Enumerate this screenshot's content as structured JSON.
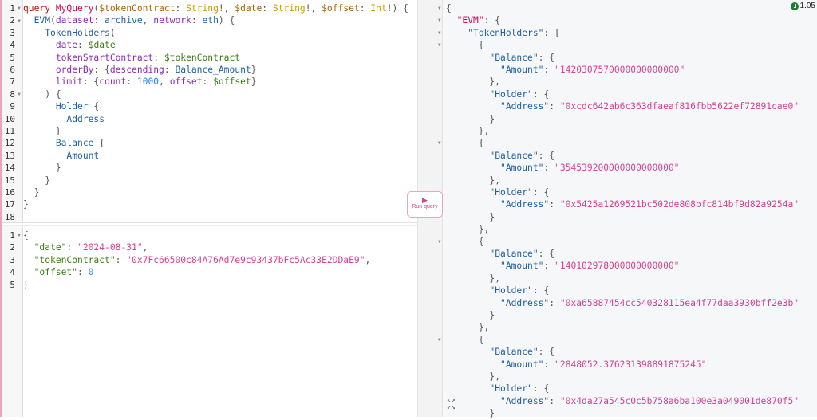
{
  "query": {
    "lines": [
      [
        [
          "query ",
          "kw"
        ],
        [
          "MyQuery",
          "def"
        ],
        [
          "(",
          "punc"
        ],
        [
          "$tokenContract",
          "var"
        ],
        [
          ": ",
          "punc"
        ],
        [
          "String",
          "type"
        ],
        [
          "!, ",
          "punc"
        ],
        [
          "$date",
          "var"
        ],
        [
          ": ",
          "punc"
        ],
        [
          "String",
          "type"
        ],
        [
          "!, ",
          "punc"
        ],
        [
          "$offset",
          "var"
        ],
        [
          ": ",
          "punc"
        ],
        [
          "Int",
          "type"
        ],
        [
          "!) {",
          "punc"
        ]
      ],
      [
        [
          "  ",
          "punc"
        ],
        [
          "EVM",
          "field"
        ],
        [
          "(",
          "punc"
        ],
        [
          "dataset",
          "arg"
        ],
        [
          ": ",
          "punc"
        ],
        [
          "archive",
          "val"
        ],
        [
          ", ",
          "punc"
        ],
        [
          "network",
          "arg"
        ],
        [
          ": ",
          "punc"
        ],
        [
          "eth",
          "val"
        ],
        [
          ") {",
          "punc"
        ]
      ],
      [
        [
          "    ",
          "punc"
        ],
        [
          "TokenHolders",
          "field"
        ],
        [
          "(",
          "punc"
        ]
      ],
      [
        [
          "      ",
          "punc"
        ],
        [
          "date",
          "arg"
        ],
        [
          ": ",
          "punc"
        ],
        [
          "$date",
          "green"
        ]
      ],
      [
        [
          "      ",
          "punc"
        ],
        [
          "tokenSmartContract",
          "arg"
        ],
        [
          ": ",
          "punc"
        ],
        [
          "$tokenContract",
          "green"
        ]
      ],
      [
        [
          "      ",
          "punc"
        ],
        [
          "orderBy",
          "arg"
        ],
        [
          ": {",
          "punc"
        ],
        [
          "descending",
          "arg"
        ],
        [
          ": ",
          "punc"
        ],
        [
          "Balance_Amount",
          "val"
        ],
        [
          "}",
          "punc"
        ]
      ],
      [
        [
          "      ",
          "punc"
        ],
        [
          "limit",
          "arg"
        ],
        [
          ": {",
          "punc"
        ],
        [
          "count",
          "arg"
        ],
        [
          ": ",
          "punc"
        ],
        [
          "1000",
          "num"
        ],
        [
          ", ",
          "punc"
        ],
        [
          "offset",
          "arg"
        ],
        [
          ": ",
          "punc"
        ],
        [
          "$offset",
          "green"
        ],
        [
          "}",
          "punc"
        ]
      ],
      [
        [
          "    ) {",
          "punc"
        ]
      ],
      [
        [
          "      ",
          "punc"
        ],
        [
          "Holder",
          "field"
        ],
        [
          " {",
          "punc"
        ]
      ],
      [
        [
          "        ",
          "punc"
        ],
        [
          "Address",
          "field"
        ]
      ],
      [
        [
          "      }",
          "punc"
        ]
      ],
      [
        [
          "      ",
          "punc"
        ],
        [
          "Balance",
          "field"
        ],
        [
          " {",
          "punc"
        ]
      ],
      [
        [
          "        ",
          "punc"
        ],
        [
          "Amount",
          "field"
        ]
      ],
      [
        [
          "      }",
          "punc"
        ]
      ],
      [
        [
          "    }",
          "punc"
        ]
      ],
      [
        [
          "  }",
          "punc"
        ]
      ],
      [
        [
          "}",
          "punc"
        ]
      ],
      [
        [
          "",
          "punc"
        ]
      ]
    ],
    "folds": [
      1,
      2,
      8
    ]
  },
  "variables": {
    "lines": [
      [
        [
          "{",
          "punc"
        ]
      ],
      [
        [
          "  ",
          "punc"
        ],
        [
          "\"date\"",
          "vkey"
        ],
        [
          ": ",
          "punc"
        ],
        [
          "\"2024-08-31\"",
          "str"
        ],
        [
          ",",
          "punc"
        ]
      ],
      [
        [
          "  ",
          "punc"
        ],
        [
          "\"tokenContract\"",
          "vkey"
        ],
        [
          ": ",
          "punc"
        ],
        [
          "\"0x7Fc66500c84A76Ad7e9c93437bFc5Ac33E2DDaE9\"",
          "str"
        ],
        [
          ",",
          "punc"
        ]
      ],
      [
        [
          "  ",
          "punc"
        ],
        [
          "\"offset\"",
          "vkey"
        ],
        [
          ": ",
          "punc"
        ],
        [
          "0",
          "num"
        ]
      ],
      [
        [
          "}",
          "punc"
        ]
      ]
    ],
    "folds": [
      1
    ]
  },
  "run_button": {
    "label": "Run query"
  },
  "timer": {
    "value": "1.05"
  },
  "result": {
    "lines": [
      [
        [
          "{",
          "punc"
        ]
      ],
      [
        [
          "  ",
          "punc"
        ],
        [
          "\"EVM\"",
          "def"
        ],
        [
          ": {",
          "punc"
        ]
      ],
      [
        [
          "    ",
          "punc"
        ],
        [
          "\"TokenHolders\"",
          "key"
        ],
        [
          ": [",
          "punc"
        ]
      ],
      [
        [
          "      {",
          "punc"
        ]
      ],
      [
        [
          "        ",
          "punc"
        ],
        [
          "\"Balance\"",
          "key"
        ],
        [
          ": {",
          "punc"
        ]
      ],
      [
        [
          "          ",
          "punc"
        ],
        [
          "\"Amount\"",
          "key"
        ],
        [
          ": ",
          "punc"
        ],
        [
          "\"1420307570000000000000\"",
          "str"
        ]
      ],
      [
        [
          "        },",
          "punc"
        ]
      ],
      [
        [
          "        ",
          "punc"
        ],
        [
          "\"Holder\"",
          "key"
        ],
        [
          ": {",
          "punc"
        ]
      ],
      [
        [
          "          ",
          "punc"
        ],
        [
          "\"Address\"",
          "key"
        ],
        [
          ": ",
          "punc"
        ],
        [
          "\"0xcdc642ab6c363dfaeaf816fbb5622ef72891cae0\"",
          "str"
        ]
      ],
      [
        [
          "        }",
          "punc"
        ]
      ],
      [
        [
          "      },",
          "punc"
        ]
      ],
      [
        [
          "      {",
          "punc"
        ]
      ],
      [
        [
          "        ",
          "punc"
        ],
        [
          "\"Balance\"",
          "key"
        ],
        [
          ": {",
          "punc"
        ]
      ],
      [
        [
          "          ",
          "punc"
        ],
        [
          "\"Amount\"",
          "key"
        ],
        [
          ": ",
          "punc"
        ],
        [
          "\"354539200000000000000\"",
          "str"
        ]
      ],
      [
        [
          "        },",
          "punc"
        ]
      ],
      [
        [
          "        ",
          "punc"
        ],
        [
          "\"Holder\"",
          "key"
        ],
        [
          ": {",
          "punc"
        ]
      ],
      [
        [
          "          ",
          "punc"
        ],
        [
          "\"Address\"",
          "key"
        ],
        [
          ": ",
          "punc"
        ],
        [
          "\"0x5425a1269521bc502de808bfc814bf9d82a9254a\"",
          "str"
        ]
      ],
      [
        [
          "        }",
          "punc"
        ]
      ],
      [
        [
          "      },",
          "punc"
        ]
      ],
      [
        [
          "      {",
          "punc"
        ]
      ],
      [
        [
          "        ",
          "punc"
        ],
        [
          "\"Balance\"",
          "key"
        ],
        [
          ": {",
          "punc"
        ]
      ],
      [
        [
          "          ",
          "punc"
        ],
        [
          "\"Amount\"",
          "key"
        ],
        [
          ": ",
          "punc"
        ],
        [
          "\"140102978000000000000\"",
          "str"
        ]
      ],
      [
        [
          "        },",
          "punc"
        ]
      ],
      [
        [
          "        ",
          "punc"
        ],
        [
          "\"Holder\"",
          "key"
        ],
        [
          ": {",
          "punc"
        ]
      ],
      [
        [
          "          ",
          "punc"
        ],
        [
          "\"Address\"",
          "key"
        ],
        [
          ": ",
          "punc"
        ],
        [
          "\"0xa65887454cc540328115ea4f77daa3930bff2e3b\"",
          "str"
        ]
      ],
      [
        [
          "        }",
          "punc"
        ]
      ],
      [
        [
          "      },",
          "punc"
        ]
      ],
      [
        [
          "      {",
          "punc"
        ]
      ],
      [
        [
          "        ",
          "punc"
        ],
        [
          "\"Balance\"",
          "key"
        ],
        [
          ": {",
          "punc"
        ]
      ],
      [
        [
          "          ",
          "punc"
        ],
        [
          "\"Amount\"",
          "key"
        ],
        [
          ": ",
          "punc"
        ],
        [
          "\"2848052.376231398891875245\"",
          "str"
        ]
      ],
      [
        [
          "        },",
          "punc"
        ]
      ],
      [
        [
          "        ",
          "punc"
        ],
        [
          "\"Holder\"",
          "key"
        ],
        [
          ": {",
          "punc"
        ]
      ],
      [
        [
          "          ",
          "punc"
        ],
        [
          "\"Address\"",
          "key"
        ],
        [
          ": ",
          "punc"
        ],
        [
          "\"0x4da27a545c0c5b758a6ba100e3a049001de870f5\"",
          "str"
        ]
      ],
      [
        [
          "        }",
          "punc"
        ]
      ]
    ],
    "folds": [
      1,
      2,
      3,
      4,
      12,
      20,
      28
    ]
  }
}
